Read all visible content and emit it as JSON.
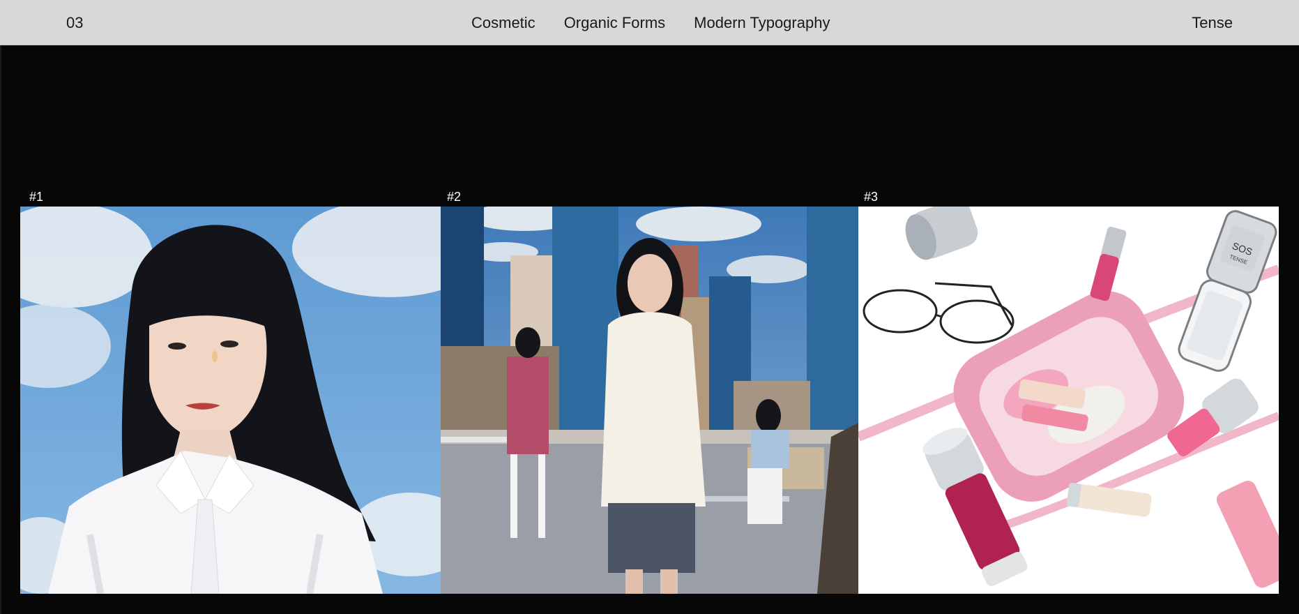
{
  "header": {
    "number": "03",
    "nav": [
      "Cosmetic",
      "Organic Forms",
      "Modern Typography"
    ],
    "brand": "Tense"
  },
  "gallery": {
    "items": [
      {
        "label": "#1",
        "image": "portrait-with-tear"
      },
      {
        "label": "#2",
        "image": "city-office-scene"
      },
      {
        "label": "#3",
        "image": "pink-bag-lip-gloss"
      }
    ]
  },
  "product_text": {
    "phone_screen": "SOS",
    "phone_brand": "TENSE"
  },
  "colors": {
    "header_bg": "#d9d8d6",
    "page_bg": "#070707",
    "accent_pink": "#e58aa6"
  }
}
